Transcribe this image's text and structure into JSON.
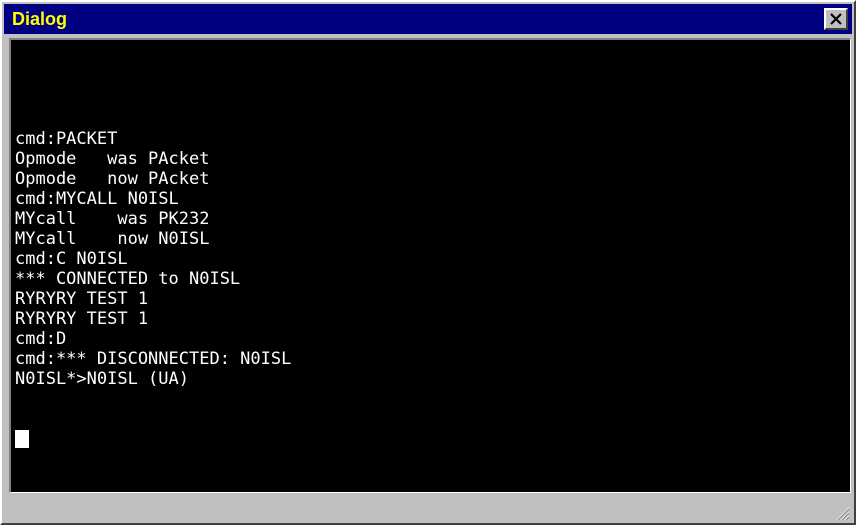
{
  "window": {
    "title": "Dialog",
    "close_icon": "close-icon"
  },
  "terminal": {
    "lines": [
      "cmd:PACKET",
      "Opmode   was PAcket",
      "Opmode   now PAcket",
      "cmd:MYCALL N0ISL",
      "MYcall    was PK232",
      "MYcall    now N0ISL",
      "cmd:C N0ISL",
      "*** CONNECTED to N0ISL",
      "RYRYRY TEST 1",
      "RYRYRY TEST 1",
      "cmd:D",
      "cmd:*** DISCONNECTED: N0ISL",
      "N0ISL*>N0ISL (UA)"
    ]
  },
  "colors": {
    "titlebar": "#000080",
    "title_text": "#ffff00",
    "terminal_bg": "#000000",
    "terminal_text": "#ffffff",
    "chrome": "#c0c0c0"
  }
}
